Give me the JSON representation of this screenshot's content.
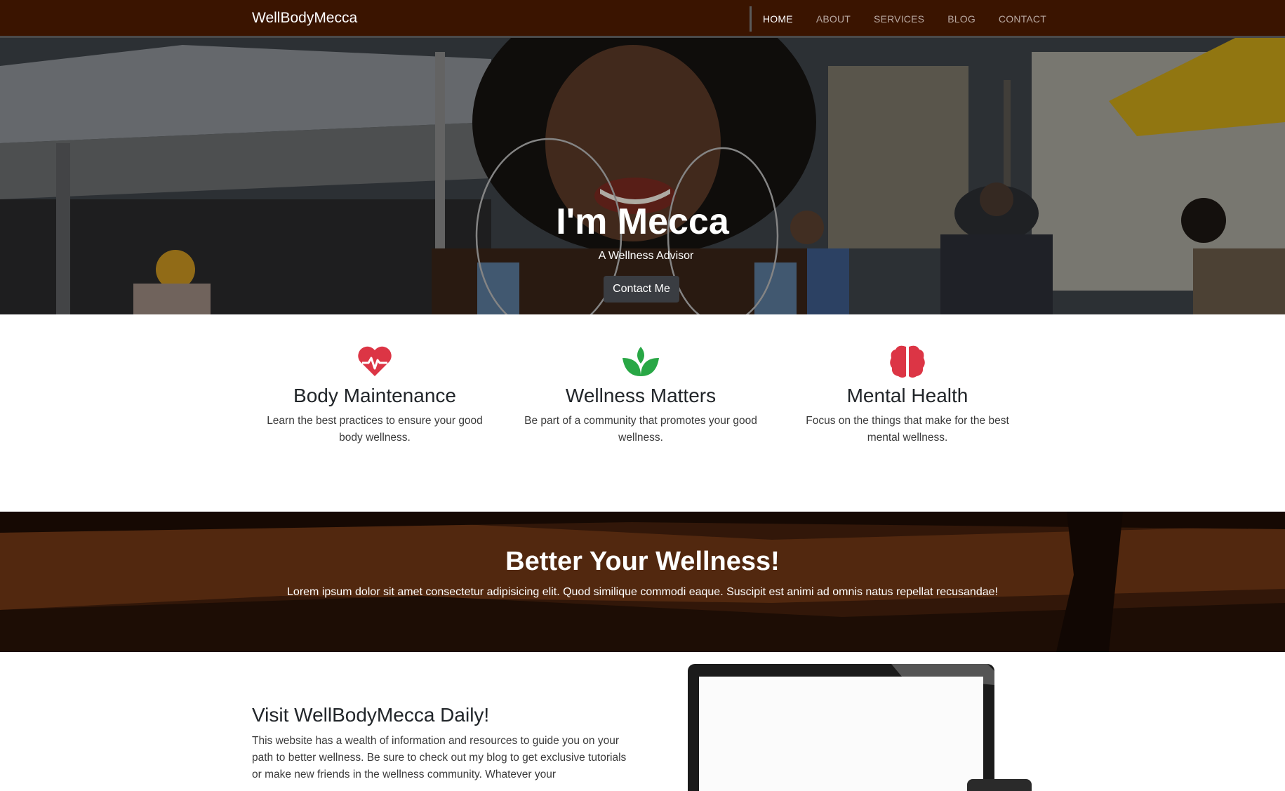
{
  "navbar": {
    "brand": "WellBodyMecca",
    "links": [
      {
        "label": "HOME",
        "active": true
      },
      {
        "label": "ABOUT",
        "active": false
      },
      {
        "label": "SERVICES",
        "active": false
      },
      {
        "label": "BLOG",
        "active": false
      },
      {
        "label": "CONTACT",
        "active": false
      }
    ]
  },
  "hero": {
    "title": "I'm Mecca",
    "subtitle": "A Wellness Advisor",
    "button_label": "Contact Me"
  },
  "features": [
    {
      "icon": "heart-pulse-icon",
      "color": "#dc3545",
      "title": "Body Maintenance",
      "text": "Learn the best practices to ensure your good body wellness."
    },
    {
      "icon": "leaf-icon",
      "color": "#28a745",
      "title": "Wellness Matters",
      "text": "Be part of a community that promotes your good wellness."
    },
    {
      "icon": "brain-icon",
      "color": "#dc3545",
      "title": "Mental Health",
      "text": "Focus on the things that make for the best mental wellness."
    }
  ],
  "banner": {
    "title": "Better Your Wellness!",
    "text": "Lorem ipsum dolor sit amet consectetur adipisicing elit. Quod similique commodi eaque. Suscipit est animi ad omnis natus repellat recusandae!"
  },
  "visit": {
    "title": "Visit WellBodyMecca Daily!",
    "text": "This website has a wealth of information and resources to guide you on your path to better wellness. Be sure to check out my blog to get exclusive tutorials or make new friends in the wellness community. Whatever your"
  },
  "colors": {
    "navbar_bg": "#3a1400",
    "button_bg": "#3a3d42",
    "accent_red": "#dc3545",
    "accent_green": "#28a745"
  }
}
